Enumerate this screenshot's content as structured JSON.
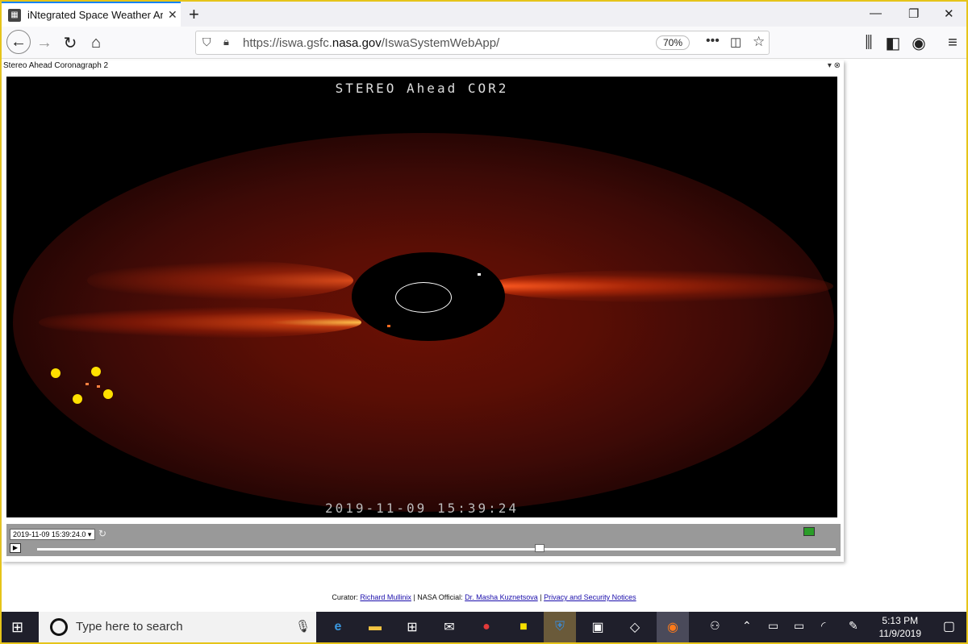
{
  "browser": {
    "tab_title": "iNtegrated Space Weather Ana",
    "url_prefix": "https://iswa.gsfc.",
    "url_domain": "nasa.gov",
    "url_path": "/IswaSystemWebApp/",
    "zoom": "70%"
  },
  "widget": {
    "title": "Stereo Ahead Coronagraph 2",
    "image_title": "STEREO Ahead COR2",
    "image_timestamp": "2019-11-09 15:39:24",
    "date_select": "2019-11-09 15:39:24.0"
  },
  "footer": {
    "curator_label": "Curator:",
    "curator_name": "Richard Mullinix",
    "nasa_label": "| NASA Official:",
    "nasa_name": "Dr. Masha Kuznetsova",
    "sep": "|",
    "privacy": "Privacy and Security Notices"
  },
  "taskbar": {
    "search_placeholder": "Type here to search",
    "time": "5:13 PM",
    "date": "11/9/2019"
  },
  "colors": {
    "accent": "#0a84ff",
    "frame": "#e6c419",
    "marker": "#ffe000"
  }
}
